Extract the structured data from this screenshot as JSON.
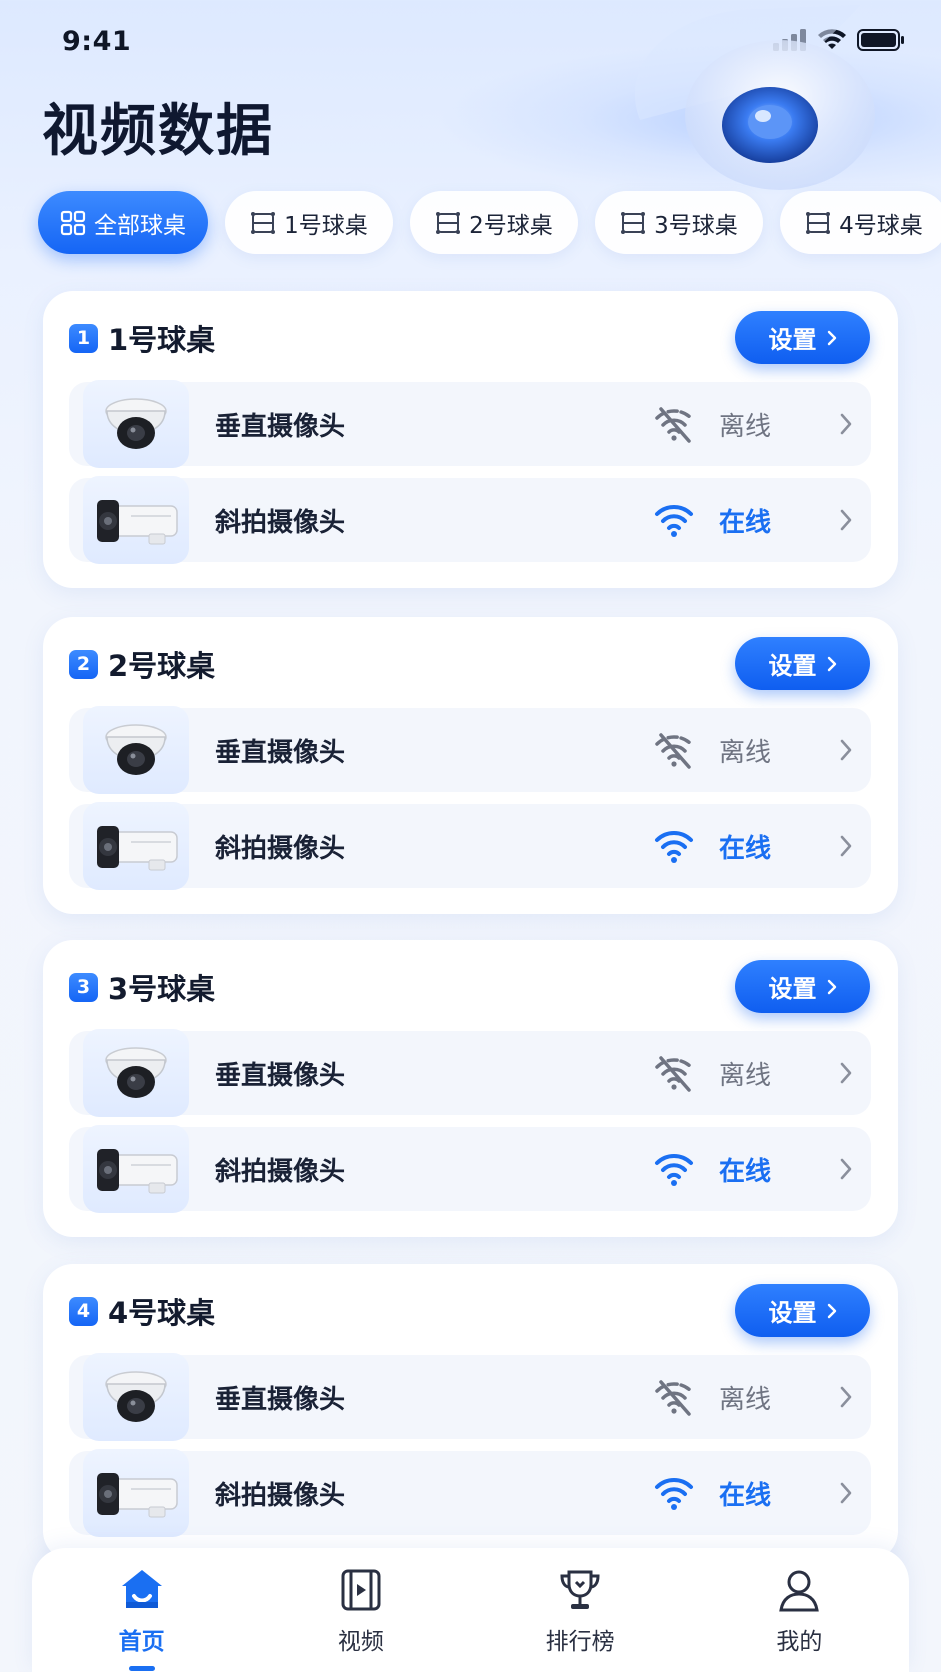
{
  "status_bar": {
    "time": "9:41"
  },
  "title": "视频数据",
  "tabs": [
    {
      "label": "全部球桌",
      "active": true
    },
    {
      "label": "1号球桌",
      "active": false
    },
    {
      "label": "2号球桌",
      "active": false
    },
    {
      "label": "3号球桌",
      "active": false
    },
    {
      "label": "4号球桌",
      "active": false
    }
  ],
  "tables": [
    {
      "number": "1",
      "name": "1号球桌",
      "settings_label": "设置",
      "cameras": [
        {
          "name": "垂直摄像头",
          "status": "离线",
          "online": false,
          "icon": "dome-camera"
        },
        {
          "name": "斜拍摄像头",
          "status": "在线",
          "online": true,
          "icon": "bullet-camera"
        }
      ]
    },
    {
      "number": "2",
      "name": "2号球桌",
      "settings_label": "设置",
      "cameras": [
        {
          "name": "垂直摄像头",
          "status": "离线",
          "online": false,
          "icon": "dome-camera"
        },
        {
          "name": "斜拍摄像头",
          "status": "在线",
          "online": true,
          "icon": "bullet-camera"
        }
      ]
    },
    {
      "number": "3",
      "name": "3号球桌",
      "settings_label": "设置",
      "cameras": [
        {
          "name": "垂直摄像头",
          "status": "离线",
          "online": false,
          "icon": "dome-camera"
        },
        {
          "name": "斜拍摄像头",
          "status": "在线",
          "online": true,
          "icon": "bullet-camera"
        }
      ]
    },
    {
      "number": "4",
      "name": "4号球桌",
      "settings_label": "设置",
      "cameras": [
        {
          "name": "垂直摄像头",
          "status": "离线",
          "online": false,
          "icon": "dome-camera"
        },
        {
          "name": "斜拍摄像头",
          "status": "在线",
          "online": true,
          "icon": "bullet-camera"
        }
      ]
    }
  ],
  "nav": [
    {
      "label": "首页",
      "icon": "home-icon",
      "active": true
    },
    {
      "label": "视频",
      "icon": "video-icon",
      "active": false
    },
    {
      "label": "排行榜",
      "icon": "trophy-icon",
      "active": false
    },
    {
      "label": "我的",
      "icon": "user-icon",
      "active": false
    }
  ],
  "colors": {
    "accent": "#1a6ff2",
    "offline": "#6f7482",
    "background": "#eef3fd"
  }
}
